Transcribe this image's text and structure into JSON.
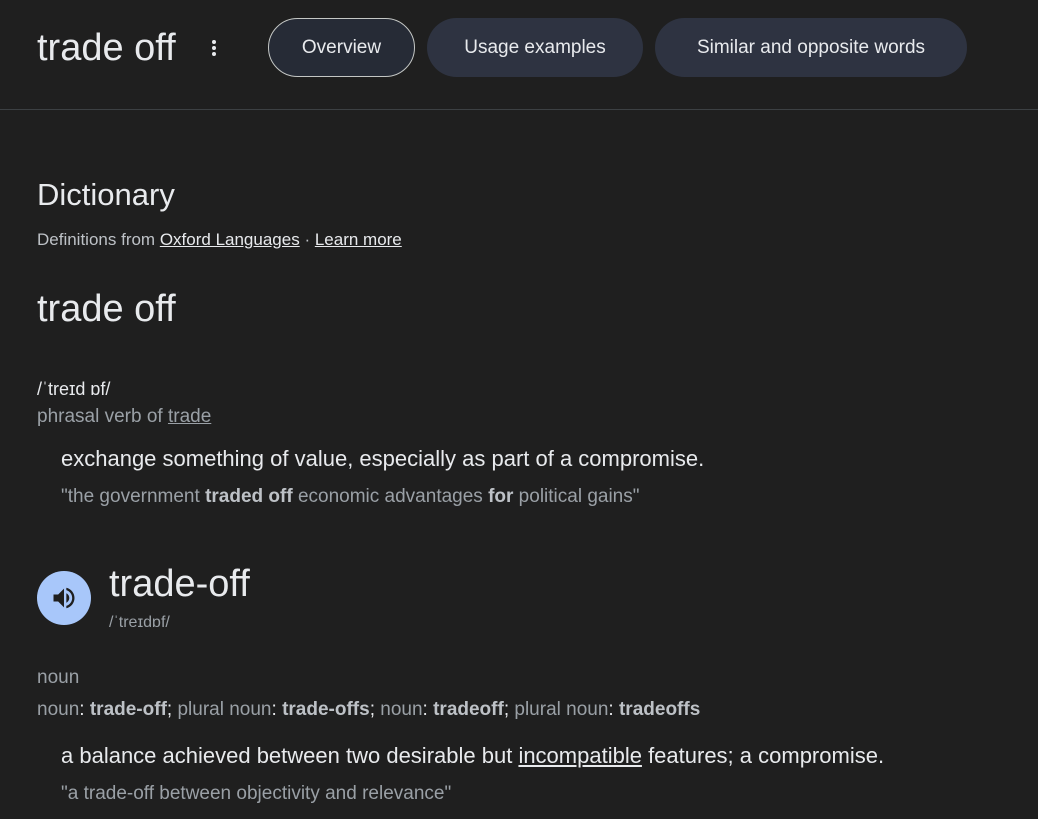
{
  "header": {
    "title": "trade off",
    "tabs": [
      {
        "label": "Overview",
        "active": true
      },
      {
        "label": "Usage examples",
        "active": false
      },
      {
        "label": "Similar and opposite words",
        "active": false
      }
    ]
  },
  "dictionary": {
    "heading": "Dictionary",
    "source_prefix": "Definitions from ",
    "source_link": "Oxford Languages",
    "separator": " · ",
    "learn_more": "Learn more"
  },
  "entry1": {
    "headword": "trade off",
    "pronunciation": "/ˈtreɪd ɒf/",
    "pos_prefix": "phrasal verb of ",
    "pos_link": "trade",
    "definition": "exchange something of value, especially as part of a compromise.",
    "example": {
      "p1": "\"the government ",
      "b1": "traded off",
      "p2": " economic advantages ",
      "b2": "for",
      "p3": " political gains\""
    }
  },
  "entry2": {
    "headword": "trade-off",
    "pronunciation": "/ˈtreɪdɒf/",
    "pos": "noun",
    "forms": [
      {
        "label": "noun",
        "value": "trade-off"
      },
      {
        "label": "plural noun",
        "value": "trade-offs"
      },
      {
        "label": "noun",
        "value": "tradeoff"
      },
      {
        "label": "plural noun",
        "value": "tradeoffs"
      }
    ],
    "definition": {
      "p1": "a balance achieved between two desirable but ",
      "link": "incompatible",
      "p2": " features; a compromise."
    },
    "example": "\"a trade-off between objectivity and relevance\""
  },
  "colors": {
    "background": "#1f1f1f",
    "chip": "#2e3341",
    "speaker": "#a8c7fa"
  },
  "icons": [
    "more-vert-icon",
    "speaker-icon"
  ]
}
